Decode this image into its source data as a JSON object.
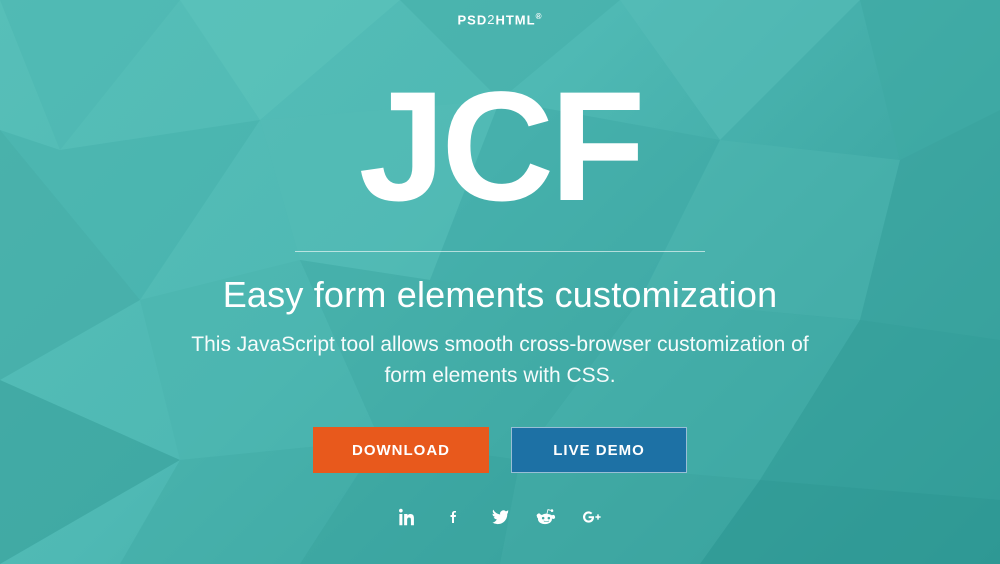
{
  "brand": {
    "segments": [
      "PSD",
      "2",
      "HTML"
    ],
    "registered": "®"
  },
  "hero": {
    "title": "JCF",
    "headline": "Easy form elements customization",
    "sub": "This JavaScript tool allows smooth cross-browser customization of form elements with CSS."
  },
  "buttons": {
    "download": "DOWNLOAD",
    "live_demo": "LIVE DEMO"
  },
  "social": {
    "items": [
      {
        "name": "linkedin"
      },
      {
        "name": "facebook"
      },
      {
        "name": "twitter"
      },
      {
        "name": "reddit"
      },
      {
        "name": "google-plus"
      }
    ]
  },
  "colors": {
    "primary_button": "#e8591c",
    "secondary_button": "#1d71a5",
    "bg_from": "#57bfb8",
    "bg_to": "#2f9a97"
  }
}
